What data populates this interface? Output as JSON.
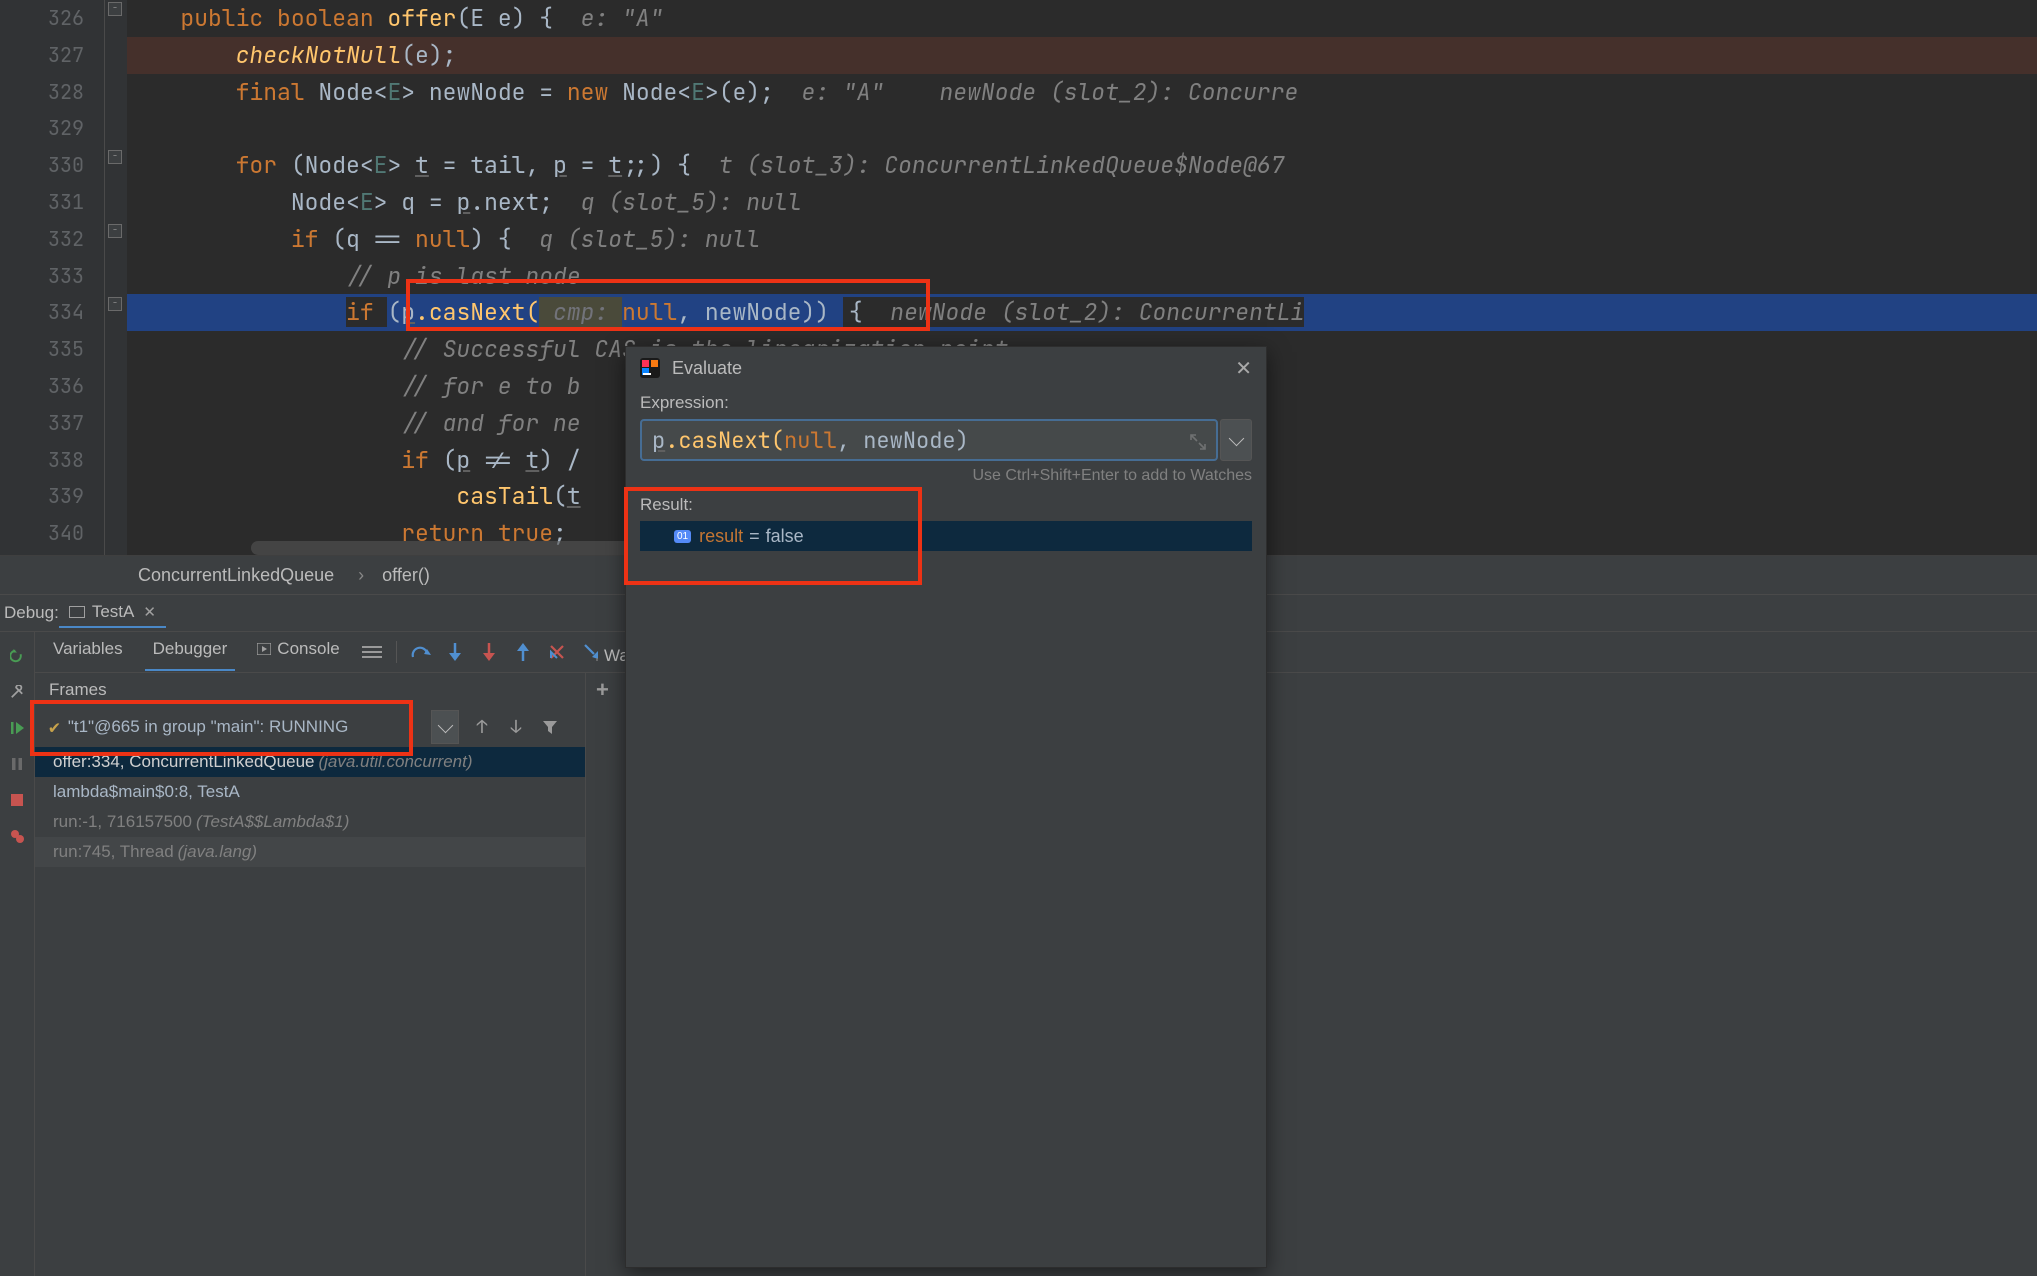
{
  "gutter": {
    "lines": [
      326,
      327,
      328,
      329,
      330,
      331,
      332,
      333,
      334,
      335,
      336,
      337,
      338,
      339,
      340
    ]
  },
  "code": {
    "l326": {
      "kw": "public ",
      "kw2": "boolean ",
      "id": "offer",
      "paren": "(E e) {",
      "hint": "  e: \"A\""
    },
    "l327": {
      "call": "checkNotNull",
      "rest": "(e);"
    },
    "l328": {
      "kw": "final ",
      "type": "Node<",
      "gen": "E",
      "type2": "> newNode = ",
      "kw2": "new ",
      "type3": "Node<",
      "gen2": "E",
      "type4": ">(e);",
      "hint": "  e: \"A\"    newNode (slot_2): Concurre"
    },
    "l330": {
      "kw": "for ",
      "paren": "(Node<",
      "gen": "E",
      "paren2": "> ",
      "under": "t",
      "rest": " = tail, ",
      "under2": "p",
      "rest2": " = ",
      "under3": "t",
      "rest3": ";;) {",
      "hint": "  t (slot_3): ConcurrentLinkedQueue$Node@67"
    },
    "l331": {
      "type": "Node<",
      "gen": "E",
      "type2": "> ",
      "id": "q ",
      "eq": "= ",
      "under": "p",
      "rest": ".next;",
      "hint": "  q (slot_5): null"
    },
    "l332": {
      "kw": "if ",
      "paren": "(q == ",
      "null": "null",
      "rest": ") {",
      "hint": "  q (slot_5): null"
    },
    "l333": {
      "cmt": "// p is last node"
    },
    "l334": {
      "kw": "if ",
      "paren": "(",
      "under": "p",
      "call": ".casNext(",
      "param": " cmp: ",
      "null": "null",
      "comma": ", newNode)",
      "end": ") ",
      "brace": "{",
      "hint": "  newNode (slot_2): ConcurrentLi"
    },
    "l335": {
      "cmt": "// Successful CAS is the linearization point"
    },
    "l336": {
      "cmt": "// for e to b"
    },
    "l337": {
      "cmt": "// and for ne"
    },
    "l338": {
      "kw": "if ",
      "paren": "(",
      "under": "p",
      "neq": " != ",
      "under2": "t",
      "rest": ") /"
    },
    "l339": {
      "call": "casTail",
      "paren": "(",
      "under": "t"
    },
    "l340": {
      "kw": "return ",
      "bool": "true",
      "semi": ";"
    }
  },
  "breadcrumb": {
    "c1": "ConcurrentLinkedQueue",
    "c2": "offer()"
  },
  "debugHeader": {
    "label": "Debug:",
    "tabName": "TestA"
  },
  "toolbar": {
    "variables": "Variables",
    "debugger": "Debugger",
    "console": "Console"
  },
  "frames": {
    "header": "Frames",
    "thread": "\"t1\"@665 in group \"main\": RUNNING",
    "rows": [
      {
        "main": "offer:334, ConcurrentLinkedQueue ",
        "extra": "(java.util.concurrent)",
        "sel": true
      },
      {
        "main": "lambda$main$0:8, TestA",
        "extra": "",
        "sel": false
      },
      {
        "main": "run:-1, 716157500 ",
        "extra": "(TestA$$Lambda$1)",
        "sel": false,
        "dim": true
      },
      {
        "main": "run:745, Thread ",
        "extra": "(java.lang)",
        "sel": false,
        "dim": true
      }
    ]
  },
  "watches": {
    "header": "Watche"
  },
  "evaluate": {
    "title": "Evaluate",
    "exprLabel": "Expression:",
    "expr": {
      "pre": "p",
      "call": ".casNext(",
      "null": "null",
      "rest": ", newNode)"
    },
    "hint": "Use Ctrl+Shift+Enter to add to Watches",
    "resultLabel": "Result:",
    "result": {
      "name": "result",
      "value": "false"
    }
  }
}
